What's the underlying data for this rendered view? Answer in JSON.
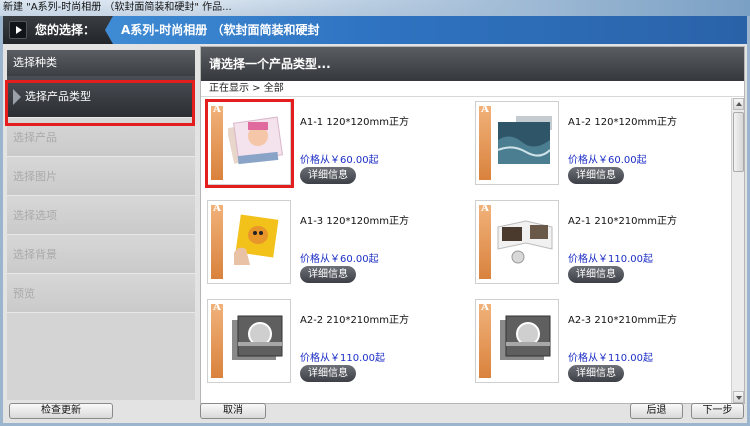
{
  "window": {
    "title": "新建 \"A系列-时尚相册 （软封面简装和硬封\" 作品..."
  },
  "header": {
    "label": "您的选择：",
    "selection": "A系列-时尚相册 （软封面简装和硬封"
  },
  "sidebar": {
    "heading": "选择种类",
    "items": [
      {
        "label": "选择产品类型",
        "active": true
      },
      {
        "label": "选择产品",
        "active": false
      },
      {
        "label": "选择图片",
        "active": false
      },
      {
        "label": "选择选项",
        "active": false
      },
      {
        "label": "选择背景",
        "active": false
      },
      {
        "label": "预览",
        "active": false
      }
    ]
  },
  "main": {
    "heading": "请选择一个产品类型...",
    "breadcrumb": "正在显示 > 全部",
    "products": [
      {
        "name": "A1-1  120*120mm正方",
        "price": "价格从￥60.00起",
        "detail": "详细信息",
        "image": "baby-photo-book"
      },
      {
        "name": "A1-2  120*120mm正方",
        "price": "价格从￥60.00起",
        "detail": "详细信息",
        "image": "ocean-photo-book"
      },
      {
        "name": "A1-3  120*120mm正方",
        "price": "价格从￥60.00起",
        "detail": "详细信息",
        "image": "giraffe-card-in-hand"
      },
      {
        "name": "A2-1  210*210mm正方",
        "price": "价格从￥110.00起",
        "detail": "详细信息",
        "image": "open-photo-book"
      },
      {
        "name": "A2-2  210*210mm正方",
        "price": "价格从￥110.00起",
        "detail": "详细信息",
        "image": "patterned-photo-book"
      },
      {
        "name": "A2-3  210*210mm正方",
        "price": "价格从￥110.00起",
        "detail": "详细信息",
        "image": "patterned-photo-book"
      }
    ]
  },
  "footer": {
    "check_updates": "检查更新",
    "cancel": "取消",
    "back": "后退",
    "next": "下一步"
  },
  "colors": {
    "highlight": "#e41d1d",
    "price": "#1c2ec5",
    "header_selection": "#2f74c2"
  }
}
